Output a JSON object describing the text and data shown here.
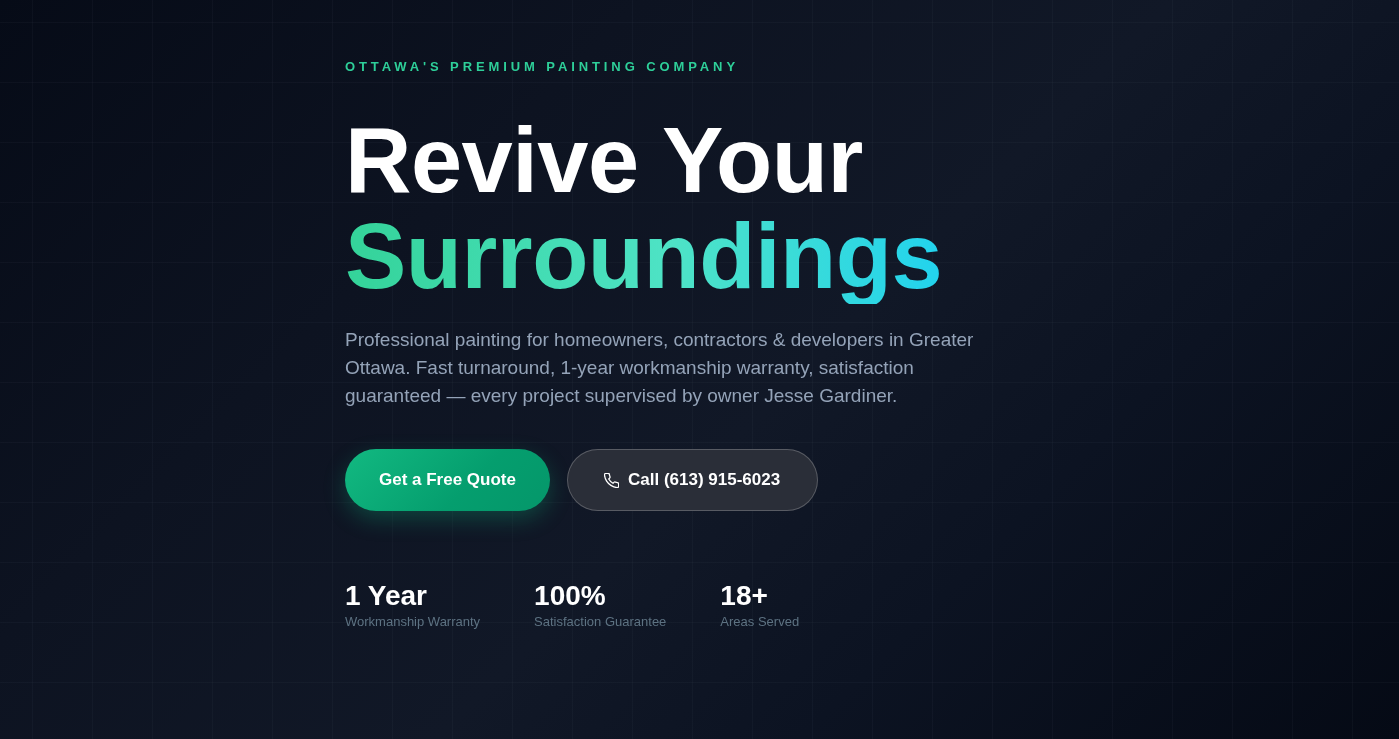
{
  "hero": {
    "eyebrow": "OTTAWA'S PREMIUM PAINTING COMPANY",
    "headline": {
      "line_1": "Revive Your",
      "line_2": "Surroundings"
    },
    "description": "Professional painting for homeowners, contractors & developers in Greater Ottawa. Fast turnaround, 1-year workmanship warranty, satisfaction guaranteed — every project supervised by owner Jesse Gardiner.",
    "buttons": [
      {
        "kind": "primary",
        "label": "Get a Free Quote"
      },
      {
        "kind": "call",
        "label": "Call (613) 915-6023"
      }
    ],
    "stats": [
      {
        "value": "1 Year",
        "label": "Workmanship Warranty"
      },
      {
        "value": "100%",
        "label": "Satisfaction Guarantee"
      },
      {
        "value": "18+",
        "label": "Areas Served"
      }
    ]
  }
}
